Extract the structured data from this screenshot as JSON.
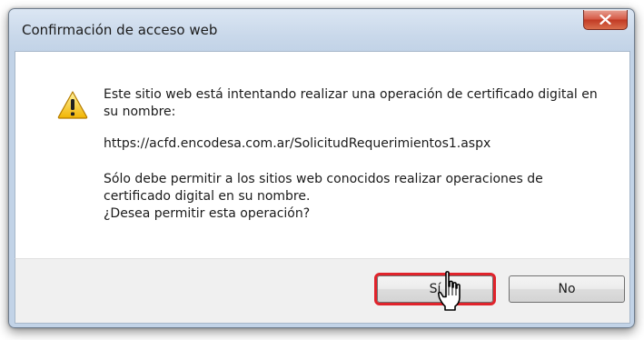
{
  "dialog": {
    "title": "Confirmación de acceso web",
    "warning_text": "Este sitio web está intentando realizar una operación de certificado digital en su nombre:",
    "url": "https://acfd.encodesa.com.ar/SolicitudRequerimientos1.aspx",
    "notice_line_1": "Sólo debe permitir a los sitios web conocidos realizar operaciones de certificado digital en su nombre.",
    "notice_line_2": "¿Desea permitir esta operación?",
    "icon": "warning-icon"
  },
  "buttons": {
    "yes_label": "Sí",
    "no_label": "No",
    "highlight_color": "#e0232b"
  },
  "pointer": {
    "icon": "hand-pointer-icon"
  }
}
